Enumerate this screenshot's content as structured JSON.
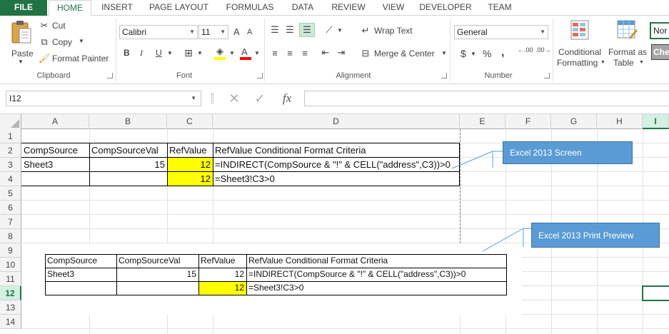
{
  "tabs": [
    "FILE",
    "HOME",
    "INSERT",
    "PAGE LAYOUT",
    "FORMULAS",
    "DATA",
    "REVIEW",
    "VIEW",
    "DEVELOPER",
    "TEAM"
  ],
  "active_tab": "HOME",
  "clipboard": {
    "paste": "Paste",
    "cut": "Cut",
    "copy": "Copy",
    "format_painter": "Format Painter",
    "label": "Clipboard"
  },
  "font": {
    "name": "Calibri",
    "size": "11",
    "label": "Font",
    "bold": "B",
    "italic": "I",
    "underline": "U",
    "grow": "A",
    "shrink": "A"
  },
  "alignment": {
    "wrap_text": "Wrap Text",
    "merge_center": "Merge & Center",
    "label": "Alignment"
  },
  "number": {
    "format": "General",
    "currency": "$",
    "percent": "%",
    "comma": ",",
    "inc_dec": ".00",
    "label": "Number"
  },
  "styles": {
    "conditional_formatting": [
      "Conditional",
      "Formatting"
    ],
    "format_as_table": [
      "Format as",
      "Table"
    ],
    "normal": "Nor",
    "check": "Che"
  },
  "formula_bar": {
    "name_box": "I12",
    "fx": "fx",
    "formula": ""
  },
  "columns": [
    "A",
    "B",
    "C",
    "D",
    "E",
    "F",
    "G",
    "H",
    "I"
  ],
  "rows": [
    "1",
    "2",
    "3",
    "4",
    "5",
    "6",
    "7",
    "8",
    "9",
    "10",
    "11",
    "12",
    "13",
    "14"
  ],
  "selected_cell": {
    "row": "12",
    "col": "I"
  },
  "screen_table": {
    "headers": [
      "CompSource",
      "CompSourceVal",
      "RefValue",
      "RefValue Conditional Format Criteria"
    ],
    "row1": [
      "Sheet3",
      "15",
      "12",
      "=INDIRECT(CompSource & \"!\" & CELL(\"address\",C3))>0"
    ],
    "row2": [
      "",
      "",
      "12",
      "=Sheet3!C3>0"
    ]
  },
  "print_table": {
    "headers": [
      "CompSource",
      "CompSourceVal",
      "RefValue",
      "RefValue Conditional Format Criteria"
    ],
    "row1": [
      "Sheet3",
      "15",
      "12",
      "=INDIRECT(CompSource & \"!\" & CELL(\"address\",C3))>0"
    ],
    "row2": [
      "",
      "",
      "12",
      "=Sheet3!C3>0"
    ]
  },
  "callouts": {
    "screen": "Excel 2013 Screen",
    "print": "Excel 2013 Print Preview"
  },
  "colors": {
    "accent": "#217346",
    "highlight": "#ffff00",
    "callout": "#5b9bd5"
  }
}
